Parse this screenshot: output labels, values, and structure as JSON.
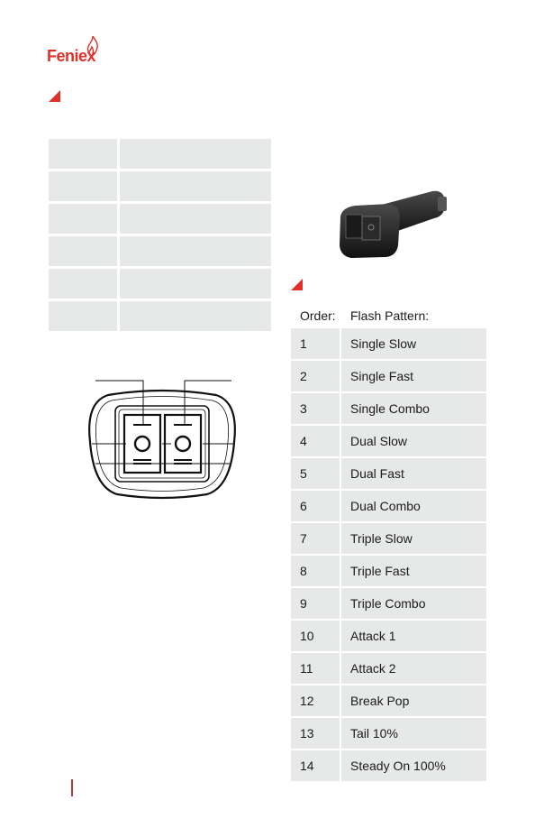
{
  "brand": {
    "name": "Feniex",
    "accent_color": "#e0302a"
  },
  "left_table": {
    "rows": [
      [
        "",
        ""
      ],
      [
        "",
        ""
      ],
      [
        "",
        ""
      ],
      [
        "",
        ""
      ],
      [
        "",
        ""
      ],
      [
        "",
        ""
      ]
    ]
  },
  "flash_table": {
    "headers": [
      "Order:",
      "Flash Pattern:"
    ],
    "rows": [
      {
        "order": "1",
        "pattern": "Single Slow"
      },
      {
        "order": "2",
        "pattern": "Single Fast"
      },
      {
        "order": "3",
        "pattern": "Single Combo"
      },
      {
        "order": "4",
        "pattern": "Dual Slow"
      },
      {
        "order": "5",
        "pattern": "Dual Fast"
      },
      {
        "order": "6",
        "pattern": "Dual Combo"
      },
      {
        "order": "7",
        "pattern": "Triple Slow"
      },
      {
        "order": "8",
        "pattern": "Triple Fast"
      },
      {
        "order": "9",
        "pattern": "Triple Combo"
      },
      {
        "order": "10",
        "pattern": "Attack 1"
      },
      {
        "order": "11",
        "pattern": "Attack 2"
      },
      {
        "order": "12",
        "pattern": "Break Pop"
      },
      {
        "order": "13",
        "pattern": "Tail 10%"
      },
      {
        "order": "14",
        "pattern": "Steady On 100%"
      }
    ]
  },
  "icons": {
    "section_marker": "red-triangle-icon",
    "logo_flame": "flame-icon",
    "product": "cigarette-plug-switch-image",
    "diagram": "dual-rocker-switch-diagram"
  }
}
